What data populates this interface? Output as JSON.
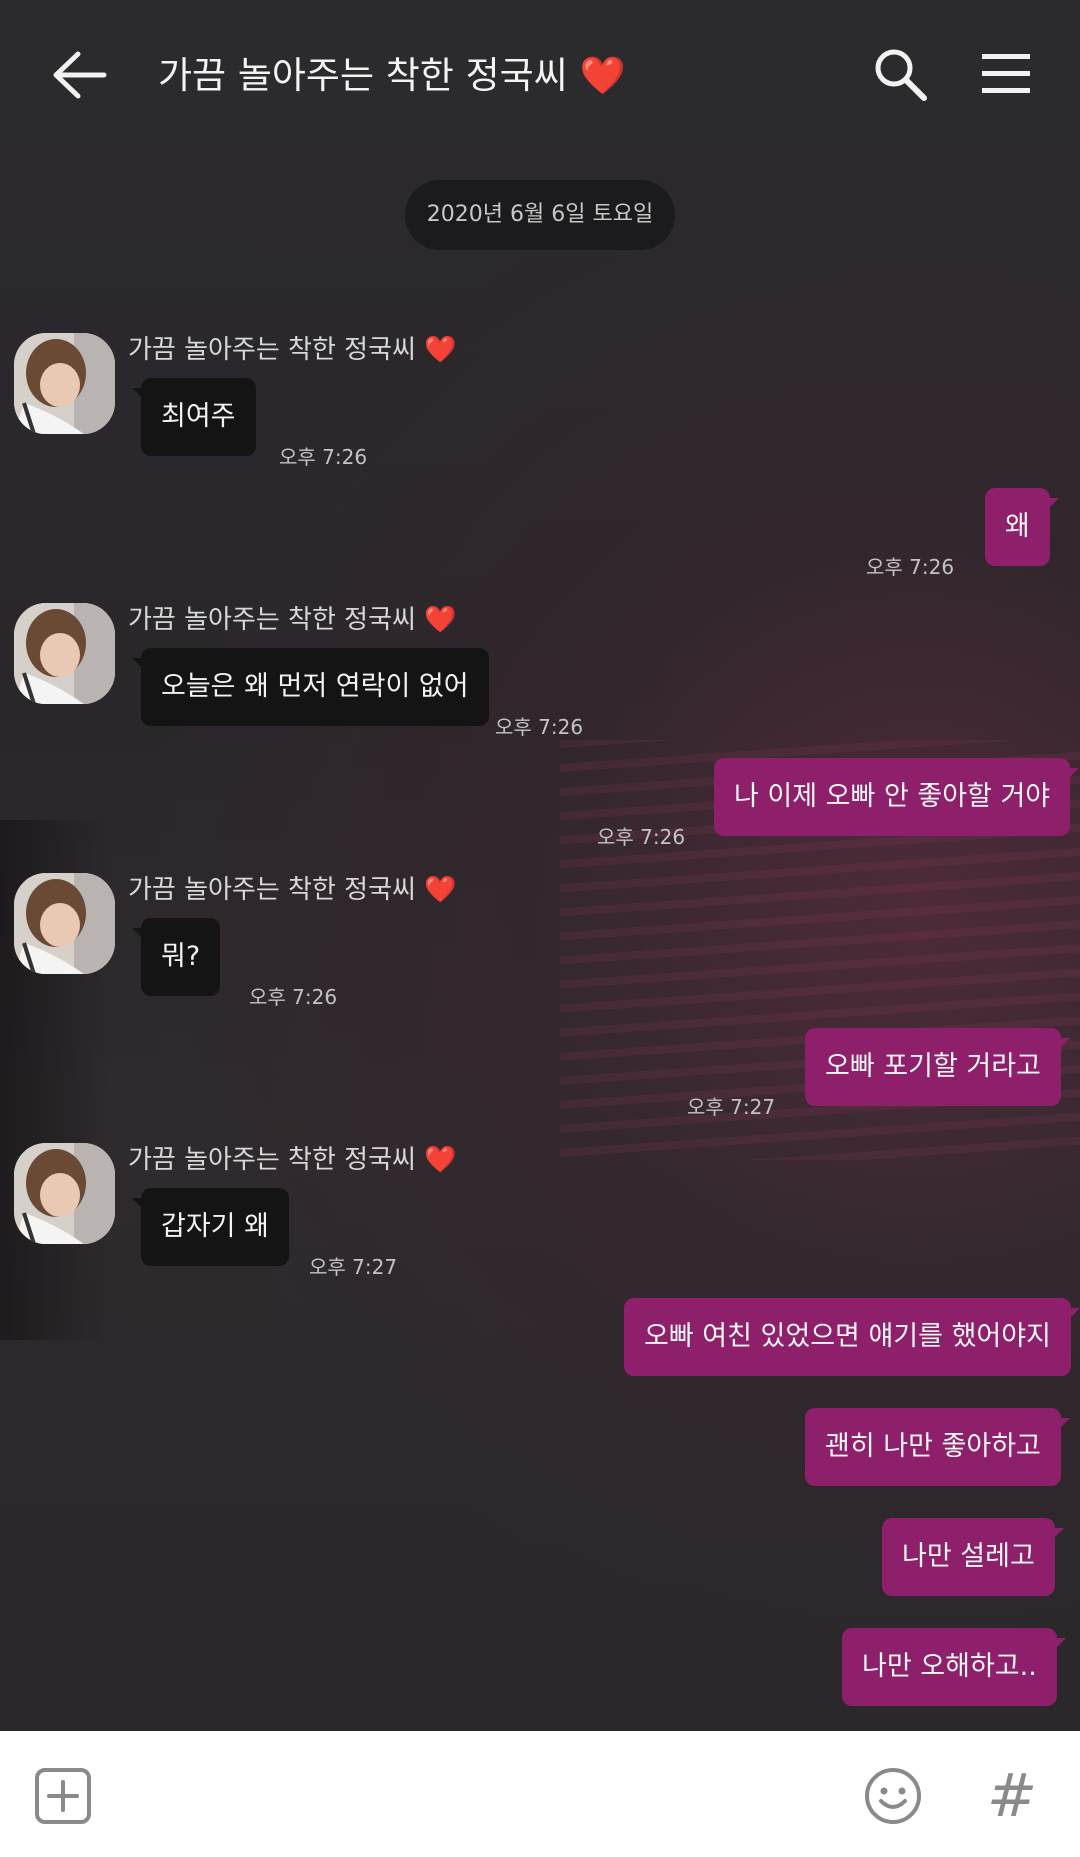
{
  "header": {
    "title": "가끔 놀아주는 착한 정국씨",
    "title_heart": "❤️",
    "back_icon": "arrow-left-icon",
    "search_icon": "search-icon",
    "menu_icon": "hamburger-menu-icon"
  },
  "date_divider": "2020년 6월 6일 토요일",
  "contact_name": "가끔 놀아주는 착한 정국씨",
  "messages": [
    {
      "dir": "in",
      "text": "최여주",
      "time": "오후 7:26"
    },
    {
      "dir": "out",
      "text": "왜",
      "time": "오후 7:26"
    },
    {
      "dir": "in",
      "text": "오늘은 왜 먼저 연락이 없어",
      "time": "오후 7:26"
    },
    {
      "dir": "out",
      "text": "나 이제 오빠 안 좋아할 거야",
      "time": "오후 7:26"
    },
    {
      "dir": "in",
      "text": "뭐?",
      "time": "오후 7:26"
    },
    {
      "dir": "out",
      "text": "오빠 포기할 거라고",
      "time": "오후 7:27"
    },
    {
      "dir": "in",
      "text": "갑자기 왜",
      "time": "오후 7:27"
    },
    {
      "dir": "out",
      "text": "오빠 여친 있었으면 얘기를 했어야지",
      "time": ""
    },
    {
      "dir": "out",
      "text": "괜히 나만 좋아하고",
      "time": ""
    },
    {
      "dir": "out",
      "text": "나만 설레고",
      "time": ""
    },
    {
      "dir": "out",
      "text": "나만 오해하고..",
      "time": ""
    }
  ],
  "input_bar": {
    "plus_icon": "plus-square-icon",
    "emoji_icon": "smiley-icon",
    "hash_label": "#"
  },
  "colors": {
    "outgoing_bubble": "#8e1f6a",
    "incoming_bubble": "#141414",
    "heart": "#e0263a"
  }
}
